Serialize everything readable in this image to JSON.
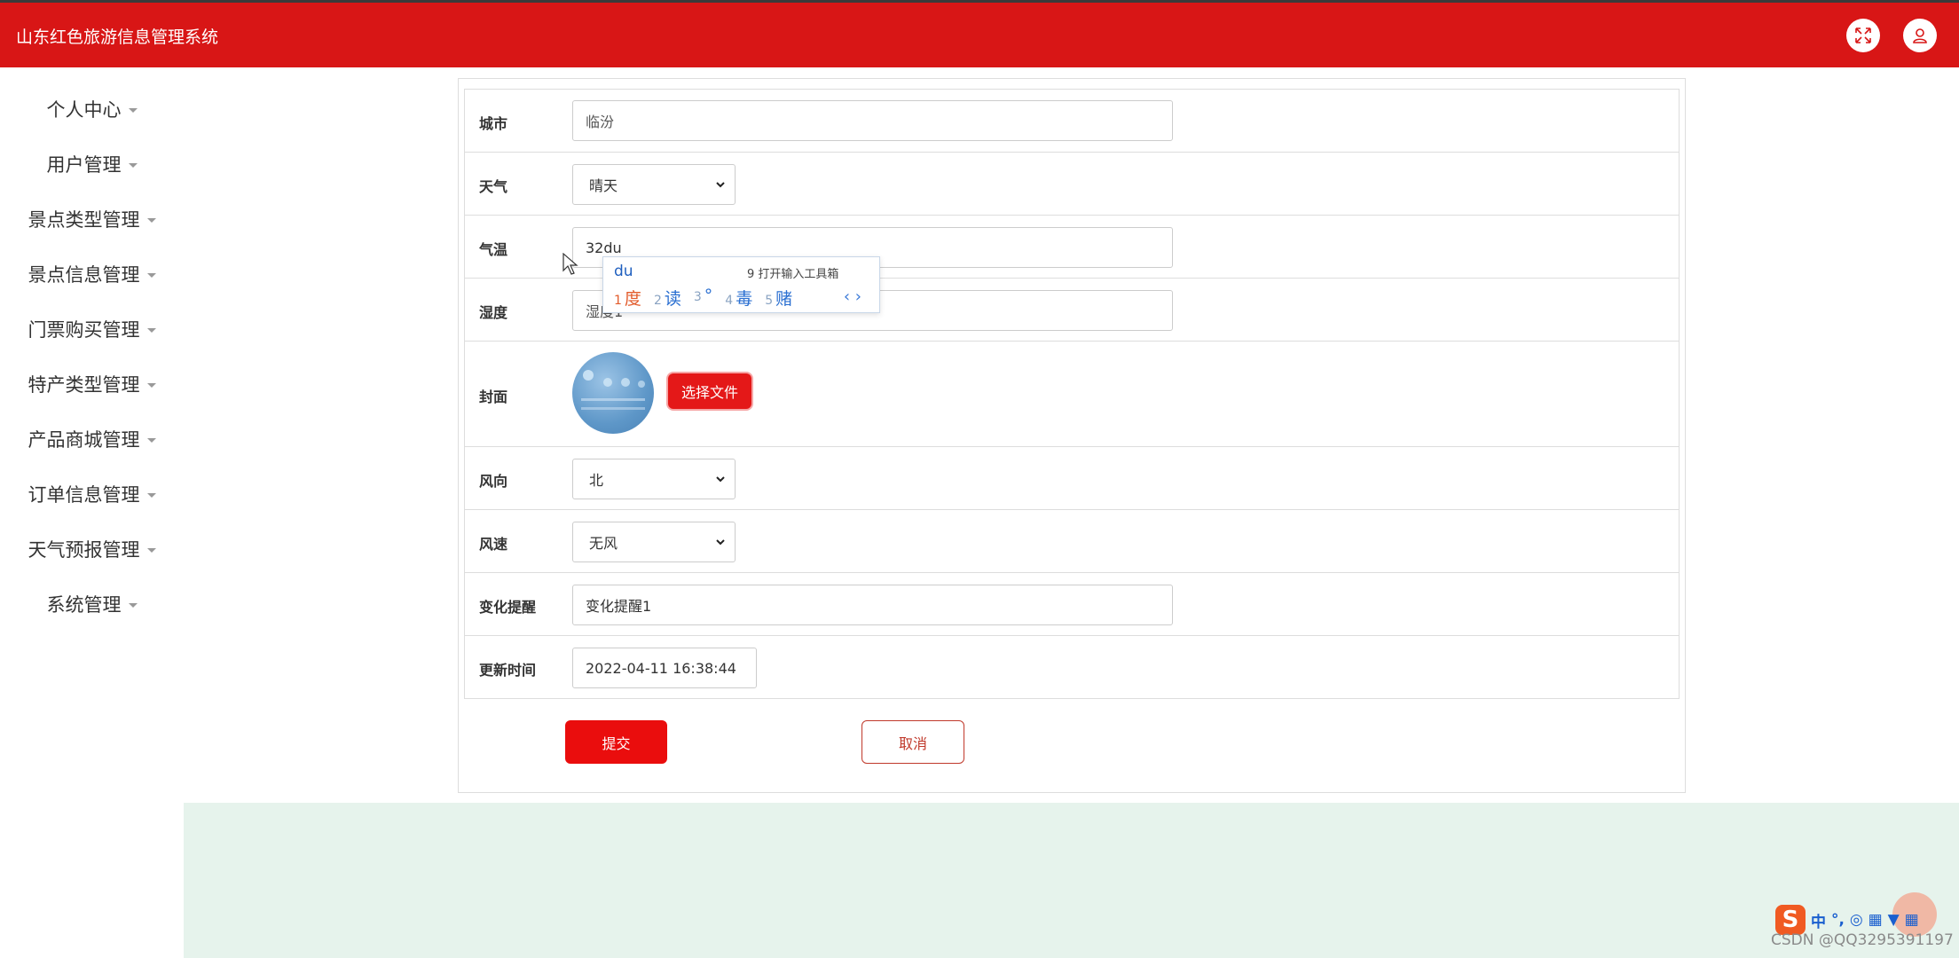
{
  "header": {
    "app_title": "山东红色旅游信息管理系统",
    "icons": [
      "fullscreen-icon",
      "user-icon"
    ],
    "color": "#d81616"
  },
  "sidebar": {
    "items": [
      {
        "label": "个人中心"
      },
      {
        "label": "用户管理"
      },
      {
        "label": "景点类型管理"
      },
      {
        "label": "景点信息管理"
      },
      {
        "label": "门票购买管理"
      },
      {
        "label": "特产类型管理"
      },
      {
        "label": "产品商城管理"
      },
      {
        "label": "订单信息管理"
      },
      {
        "label": "天气预报管理"
      },
      {
        "label": "系统管理"
      }
    ]
  },
  "form": {
    "city": {
      "label": "城市",
      "value": "临汾"
    },
    "weather": {
      "label": "天气",
      "selected": "晴天"
    },
    "temperature": {
      "label": "气温",
      "value": "32du"
    },
    "humidity": {
      "label": "湿度",
      "value": "湿度1"
    },
    "cover": {
      "label": "封面",
      "button_label": "选择文件"
    },
    "wind_direction": {
      "label": "风向",
      "selected": "北"
    },
    "wind_speed": {
      "label": "风速",
      "selected": "无风"
    },
    "change_reminder": {
      "label": "变化提醒",
      "value": "变化提醒1"
    },
    "update_time": {
      "label": "更新时间",
      "value": "2022-04-11 16:38:44"
    },
    "submit_label": "提交",
    "cancel_label": "取消"
  },
  "ime_popup": {
    "composition": "du",
    "toolbox_hint": "9 打开输入工具箱",
    "candidates": [
      {
        "num": "1",
        "text": "度"
      },
      {
        "num": "2",
        "text": "读"
      },
      {
        "num": "3",
        "text": "°"
      },
      {
        "num": "4",
        "text": "毒"
      },
      {
        "num": "5",
        "text": "赌"
      }
    ],
    "nav": "‹ ›"
  },
  "taskbar": {
    "ime_mode": "中",
    "ime_tools": "°, ◎ ▦ ▼ ▦",
    "watermark": "CSDN @QQ3295391197"
  },
  "colors": {
    "accent": "#d81616",
    "button": "#ea0d0d",
    "content_bg": "#e6f3ec"
  }
}
